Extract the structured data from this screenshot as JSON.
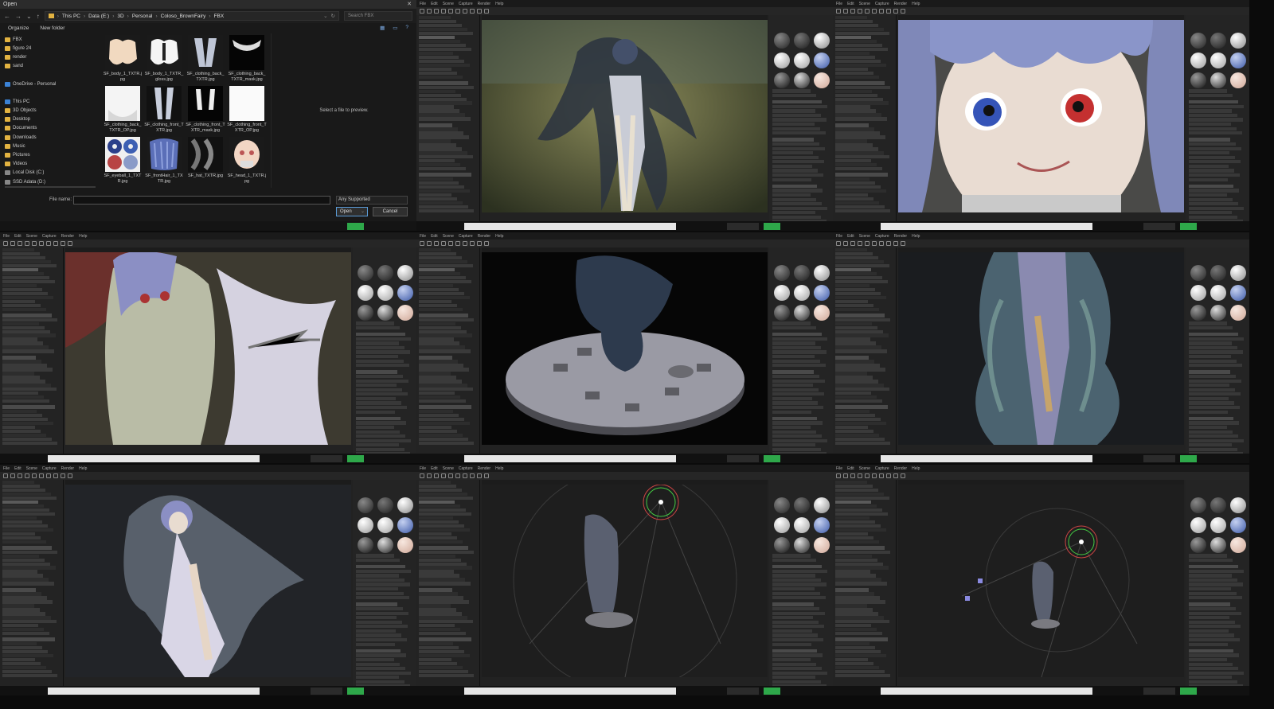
{
  "file_dialog": {
    "title": "Open",
    "breadcrumb": [
      "This PC",
      "Data (E:)",
      "3D",
      "Personal",
      "Coloso_BrownFairy",
      "FBX"
    ],
    "search_placeholder": "Search FBX",
    "organize_label": "Organize",
    "new_folder_label": "New folder",
    "nav_items": [
      {
        "label": "FBX",
        "icon": "folder-icon"
      },
      {
        "label": "figure 24",
        "icon": "folder-icon"
      },
      {
        "label": "render",
        "icon": "folder-icon"
      },
      {
        "label": "sand",
        "icon": "folder-icon"
      },
      {
        "label": "",
        "icon": ""
      },
      {
        "label": "OneDrive - Personal",
        "icon": "cloud-icon"
      },
      {
        "label": "",
        "icon": ""
      },
      {
        "label": "This PC",
        "icon": "pc-icon"
      },
      {
        "label": "3D Objects",
        "icon": "folder-icon"
      },
      {
        "label": "Desktop",
        "icon": "folder-icon"
      },
      {
        "label": "Documents",
        "icon": "folder-icon"
      },
      {
        "label": "Downloads",
        "icon": "folder-icon"
      },
      {
        "label": "Music",
        "icon": "folder-icon"
      },
      {
        "label": "Pictures",
        "icon": "folder-icon"
      },
      {
        "label": "Videos",
        "icon": "folder-icon"
      },
      {
        "label": "Local Disk (C:)",
        "icon": "drive-icon"
      },
      {
        "label": "SSD Adata (D:)",
        "icon": "drive-icon"
      },
      {
        "label": "Data (E:)",
        "icon": "drive-icon"
      }
    ],
    "files": [
      {
        "name": "SF_body_1_TXTR.jpg",
        "thumb": "skin-body"
      },
      {
        "name": "SF_body_1_TXTR_gloss.jpg",
        "thumb": "white-body"
      },
      {
        "name": "SF_clothing_back_TXTR.jpg",
        "thumb": "cloth-grey"
      },
      {
        "name": "SF_clothing_back_TXTR_mask.jpg",
        "thumb": "cloth-black"
      },
      {
        "name": "SF_clothing_back_TXTR_OP.jpg",
        "thumb": "white-op"
      },
      {
        "name": "SF_clothing_front_TXTR.jpg",
        "thumb": "front-grey"
      },
      {
        "name": "SF_clothing_front_TXTR_mask.jpg",
        "thumb": "front-black"
      },
      {
        "name": "SF_clothing_front_TXTR_OP.jpg",
        "thumb": "white-plain"
      },
      {
        "name": "SF_eyeball_1_TXTR.jpg",
        "thumb": "eyes"
      },
      {
        "name": "SF_frontHair_1_TXTR.jpg",
        "thumb": "hair-blue"
      },
      {
        "name": "SF_hat_TXTR.jpg",
        "thumb": "hat-dark"
      },
      {
        "name": "SF_head_1_TXTR.jpg",
        "thumb": "head-skin"
      }
    ],
    "preview_text": "Select a file to preview.",
    "file_name_label": "File name:",
    "file_name_value": "",
    "file_type": "Any Supported",
    "open_label": "Open",
    "cancel_label": "Cancel"
  },
  "app_menu": [
    "File",
    "Edit",
    "Scene",
    "Capture",
    "Render",
    "Help"
  ],
  "panels": [
    {
      "id": "viewport-fairy-full",
      "scene": "fairy-full"
    },
    {
      "id": "viewport-face-closeup",
      "scene": "face"
    },
    {
      "id": "viewport-torso",
      "scene": "torso"
    },
    {
      "id": "viewport-base",
      "scene": "base"
    },
    {
      "id": "viewport-dress",
      "scene": "dress"
    },
    {
      "id": "viewport-pose",
      "scene": "pose"
    },
    {
      "id": "viewport-light-left",
      "scene": "light1"
    },
    {
      "id": "viewport-light-right",
      "scene": "light2"
    }
  ],
  "colors": {
    "accent_green": "#2ea84a",
    "ui_dark": "#222222",
    "dialog_bg": "#191919"
  }
}
